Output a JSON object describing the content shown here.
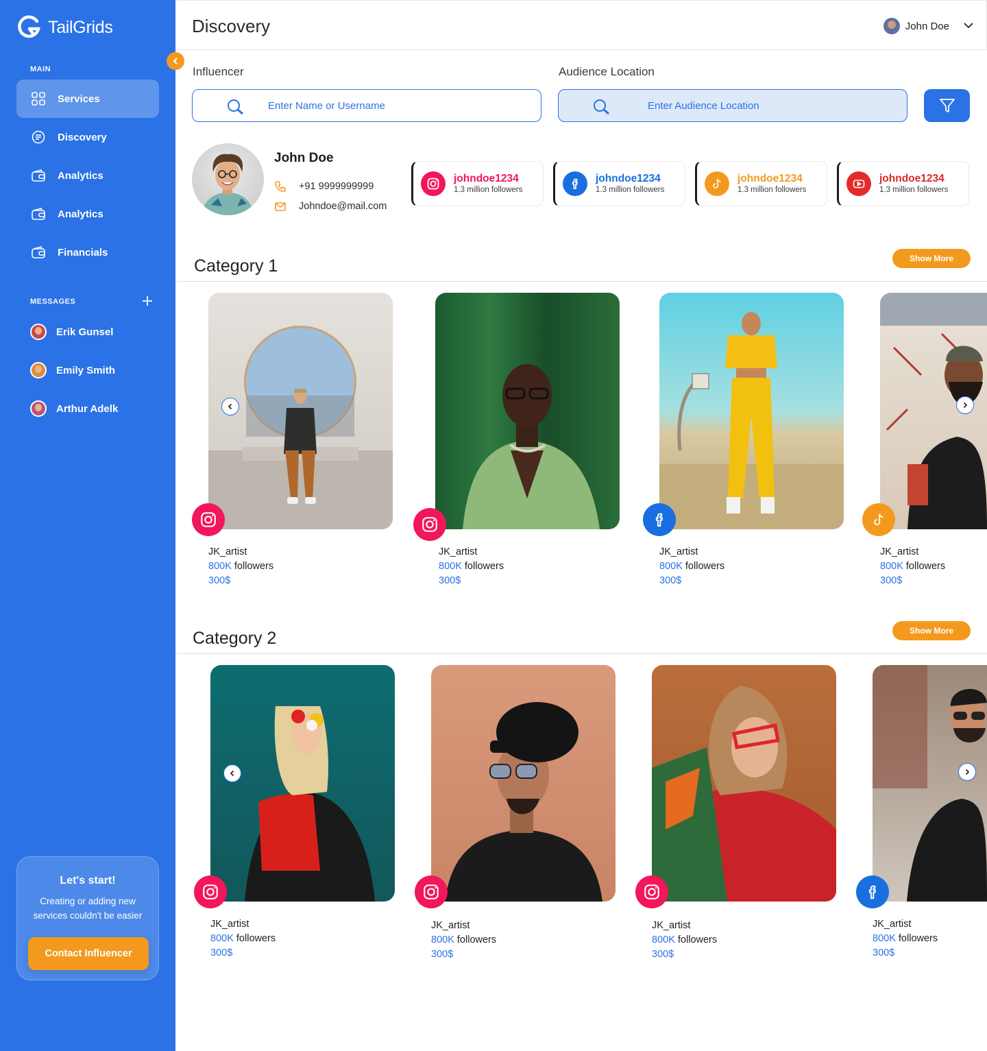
{
  "brand": {
    "name": "TailGrids"
  },
  "sidebar": {
    "main_label": "MAIN",
    "items": [
      {
        "label": "Services",
        "icon": "grid-icon",
        "active": true
      },
      {
        "label": "Discovery",
        "icon": "document-icon"
      },
      {
        "label": "Analytics",
        "icon": "wallet-icon"
      },
      {
        "label": "Analytics",
        "icon": "wallet-icon"
      },
      {
        "label": "Financials",
        "icon": "wallet-icon"
      }
    ],
    "messages_label": "MESSAGES",
    "messages": [
      {
        "name": "Erik Gunsel"
      },
      {
        "name": "Emily Smith"
      },
      {
        "name": "Arthur Adelk"
      }
    ],
    "cta": {
      "title": "Let's start!",
      "description": "Creating or adding new services couldn't be easier",
      "button": "Contact Influencer"
    }
  },
  "header": {
    "title": "Discovery",
    "user_name": "John Doe"
  },
  "search": {
    "influencer_label": "Influencer",
    "influencer_placeholder": "Enter Name or Username",
    "location_label": "Audience Location",
    "location_placeholder": "Enter Audience Location"
  },
  "profile": {
    "name": "John Doe",
    "phone": "+91 9999999999",
    "email": "Johndoe@mail.com",
    "socials": [
      {
        "platform": "instagram",
        "handle": "johndoe1234",
        "followers": "1.3 million followers",
        "color": "#f2165a"
      },
      {
        "platform": "facebook",
        "handle": "johndoe1234",
        "followers": "1.3 million followers",
        "color": "#1a6fe0"
      },
      {
        "platform": "tiktok",
        "handle": "johndoe1234",
        "followers": "1.3 million followers",
        "color": "#f39a1e"
      },
      {
        "platform": "youtube",
        "handle": "johndoe1234",
        "followers": "1.3 million followers",
        "color": "#d92a2a"
      }
    ]
  },
  "categories": [
    {
      "title": "Category 1",
      "show_more": "Show More",
      "cards": [
        {
          "platform": "instagram",
          "name": "JK_artist",
          "followers_value": "800K",
          "followers_suffix": "followers",
          "price": "300$"
        },
        {
          "platform": "instagram",
          "name": "JK_artist",
          "followers_value": "800K",
          "followers_suffix": "followers",
          "price": "300$"
        },
        {
          "platform": "facebook",
          "name": "JK_artist",
          "followers_value": "800K",
          "followers_suffix": "followers",
          "price": "300$"
        },
        {
          "platform": "tiktok",
          "name": "JK_artist",
          "followers_value": "800K",
          "followers_suffix": "followers",
          "price": "300$"
        }
      ]
    },
    {
      "title": "Category 2",
      "show_more": "Show More",
      "cards": [
        {
          "platform": "instagram",
          "name": "JK_artist",
          "followers_value": "800K",
          "followers_suffix": "followers",
          "price": "300$"
        },
        {
          "platform": "instagram",
          "name": "JK_artist",
          "followers_value": "800K",
          "followers_suffix": "followers",
          "price": "300$"
        },
        {
          "platform": "instagram",
          "name": "JK_artist",
          "followers_value": "800K",
          "followers_suffix": "followers",
          "price": "300$"
        },
        {
          "platform": "facebook",
          "name": "JK_artist",
          "followers_value": "800K",
          "followers_suffix": "followers",
          "price": "300$"
        }
      ]
    }
  ],
  "colors": {
    "primary": "#2a72e5",
    "accent": "#f39a1e",
    "instagram": "#f2165a",
    "facebook": "#1a6fe0",
    "youtube": "#e42a2a"
  }
}
